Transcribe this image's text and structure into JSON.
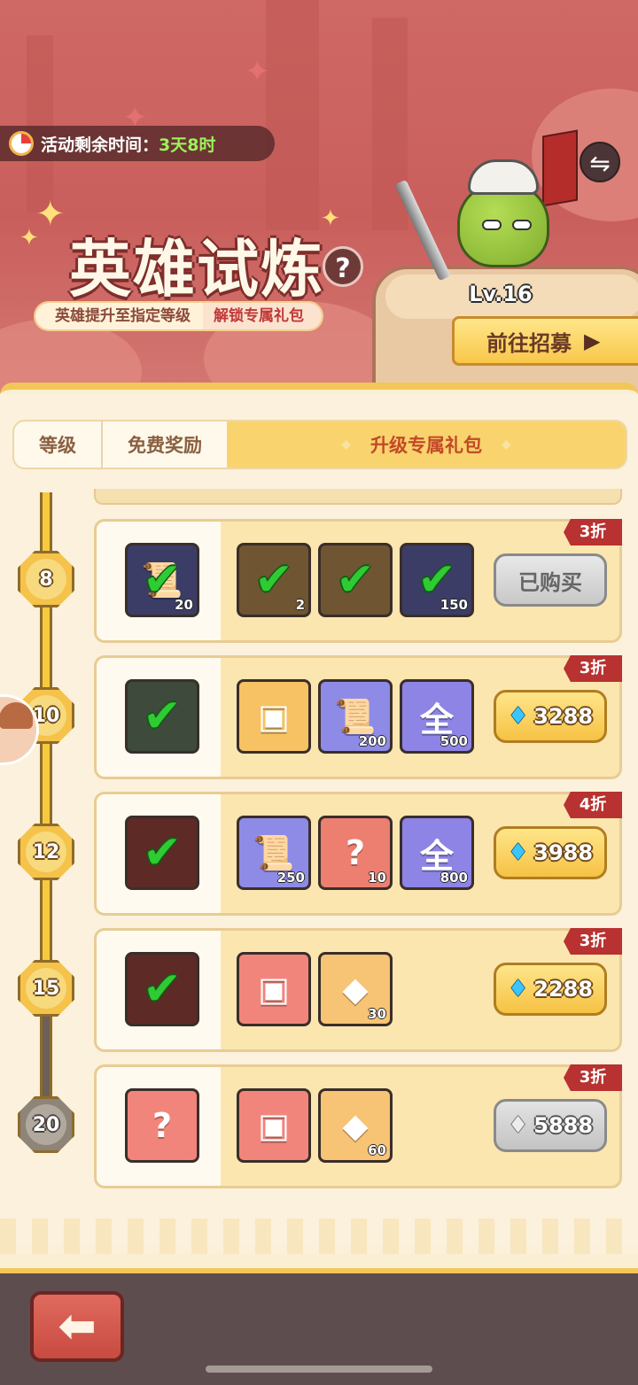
{
  "event": {
    "timer_label": "活动剩余时间：",
    "timer_value": "3天8时",
    "title": "英雄试炼",
    "help": "?",
    "subtitle_left": "英雄提升至指定等级",
    "subtitle_right": "解锁专属礼包",
    "hero_level": "Lv.16",
    "swap_icon": "⇋",
    "recruit_label": "前往招募",
    "recruit_arrow": "▶"
  },
  "tabs": {
    "level": "等级",
    "free": "免费奖励",
    "exclusive": "升级专属礼包",
    "exclusive_deco": "◆"
  },
  "tiers": [
    {
      "level": "8",
      "discount": "3折",
      "free_item": {
        "icon": "integral-scroll-icon",
        "count": "20",
        "claimed": true
      },
      "pack_items": [
        {
          "icon": "orc-hero-icon",
          "count": "2",
          "claimed": true
        },
        {
          "icon": "treasure-chest-icon",
          "count": "",
          "claimed": true
        },
        {
          "icon": "integral-scroll-icon",
          "count": "150",
          "claimed": true
        }
      ],
      "price": "已购买",
      "purchased": true
    },
    {
      "level": "10",
      "discount": "3折",
      "free_item": {
        "icon": "hero-frames-icon",
        "count": "",
        "claimed": true
      },
      "pack_items": [
        {
          "icon": "purple-chest-icon",
          "count": ""
        },
        {
          "icon": "integral-scroll-icon",
          "count": "200"
        },
        {
          "icon": "universal-orb-icon",
          "count": "500",
          "glyph": "全"
        }
      ],
      "price": "3288"
    },
    {
      "level": "12",
      "discount": "4折",
      "free_item": {
        "icon": "card-back-icon",
        "count": "",
        "claimed": true
      },
      "pack_items": [
        {
          "icon": "integral-scroll-icon",
          "count": "250"
        },
        {
          "icon": "puzzle-piece-icon",
          "count": "10"
        },
        {
          "icon": "universal-orb-icon",
          "count": "800",
          "glyph": "全"
        }
      ],
      "price": "3988"
    },
    {
      "level": "15",
      "discount": "3折",
      "free_item": {
        "icon": "card-back-icon",
        "count": "",
        "claimed": true
      },
      "pack_items": [
        {
          "icon": "red-gold-chest-icon",
          "count": ""
        },
        {
          "icon": "fire-crystal-icon",
          "count": "30"
        }
      ],
      "price": "2288"
    },
    {
      "level": "20",
      "discount": "3折",
      "locked": true,
      "free_item": {
        "icon": "mystery-chest-icon",
        "count": ""
      },
      "pack_items": [
        {
          "icon": "green-gem-chest-icon",
          "count": ""
        },
        {
          "icon": "fire-crystal-icon",
          "count": "60"
        }
      ],
      "price": "5888"
    }
  ],
  "footer": {
    "back_icon": "⬅"
  },
  "colors": {
    "accent_gold": "#f6c243",
    "discount_red": "#b73230",
    "check_green": "#2ecb32",
    "timer_green": "#9bf25a"
  }
}
